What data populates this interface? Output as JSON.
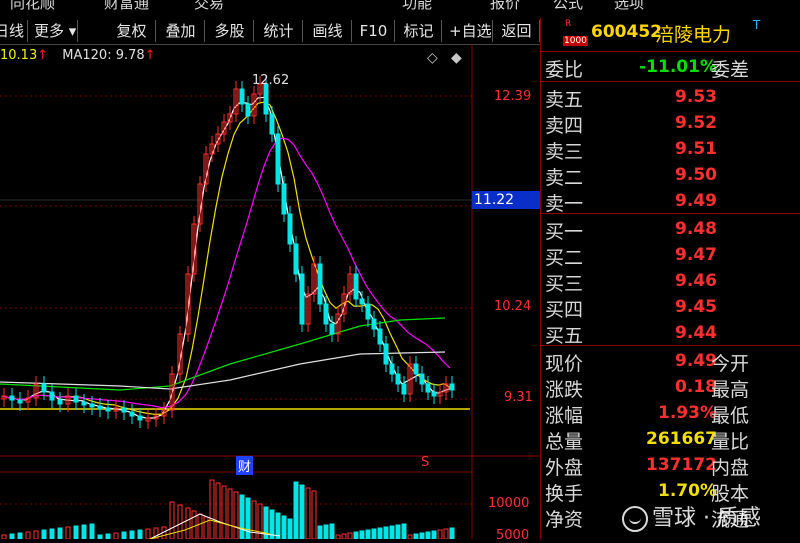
{
  "top_menu": [
    "同花顺",
    "财富通",
    "交易",
    "功能",
    "报价",
    "公式",
    "选项"
  ],
  "toolbar": {
    "period": "日线",
    "more": "更多",
    "buttons": [
      "复权",
      "叠加",
      "多股",
      "统计",
      "画线",
      "F10",
      "标记",
      "+自选",
      "返回"
    ]
  },
  "legend": {
    "ma1_value": "10.13",
    "ma2_label": "MA120: 9.78",
    "arrow": "↑"
  },
  "chart": {
    "high_label": "12.62",
    "axis_labels": [
      "12.39",
      "10.24",
      "9.31"
    ],
    "current_price_tag": "11.22",
    "cai_mark": "财",
    "s_mark": "S",
    "vol_labels": [
      "10000",
      "5000"
    ]
  },
  "stock": {
    "r_label": "R",
    "r_num": "1000",
    "code": "600452",
    "name": "涪陵电力",
    "badge": "T"
  },
  "weibi": {
    "label": "委比",
    "value": "-11.01%",
    "label2": "委差"
  },
  "sell": [
    {
      "label": "卖五",
      "price": "9.53"
    },
    {
      "label": "卖四",
      "price": "9.52"
    },
    {
      "label": "卖三",
      "price": "9.51"
    },
    {
      "label": "卖二",
      "price": "9.50"
    },
    {
      "label": "卖一",
      "price": "9.49"
    }
  ],
  "buy": [
    {
      "label": "买一",
      "price": "9.48"
    },
    {
      "label": "买二",
      "price": "9.47"
    },
    {
      "label": "买三",
      "price": "9.46"
    },
    {
      "label": "买四",
      "price": "9.45"
    },
    {
      "label": "买五",
      "price": "9.44"
    }
  ],
  "quote": [
    {
      "label": "现价",
      "value": "9.49",
      "label2": "今开",
      "color": "red"
    },
    {
      "label": "涨跌",
      "value": "0.18",
      "label2": "最高",
      "color": "red"
    },
    {
      "label": "涨幅",
      "value": "1.93%",
      "label2": "最低",
      "color": "red"
    },
    {
      "label": "总量",
      "value": "261667",
      "label2": "量比",
      "color": "yellow"
    },
    {
      "label": "外盘",
      "value": "137172",
      "label2": "内盘",
      "color": "red"
    },
    {
      "label": "换手",
      "value": "1.70%",
      "label2": "股本",
      "color": "yellow"
    },
    {
      "label": "净资",
      "value": "",
      "label2": "流通",
      "color": "yellow"
    }
  ],
  "watermark": "雪球 · 质感",
  "colors": {
    "up": "#ff3030",
    "down": "#00e6e6",
    "ma5": "#ffffff",
    "ma10": "#f0e000",
    "ma20": "#ff00ff",
    "ma60": "#00e000",
    "ma120": "#e0e0e0"
  }
}
